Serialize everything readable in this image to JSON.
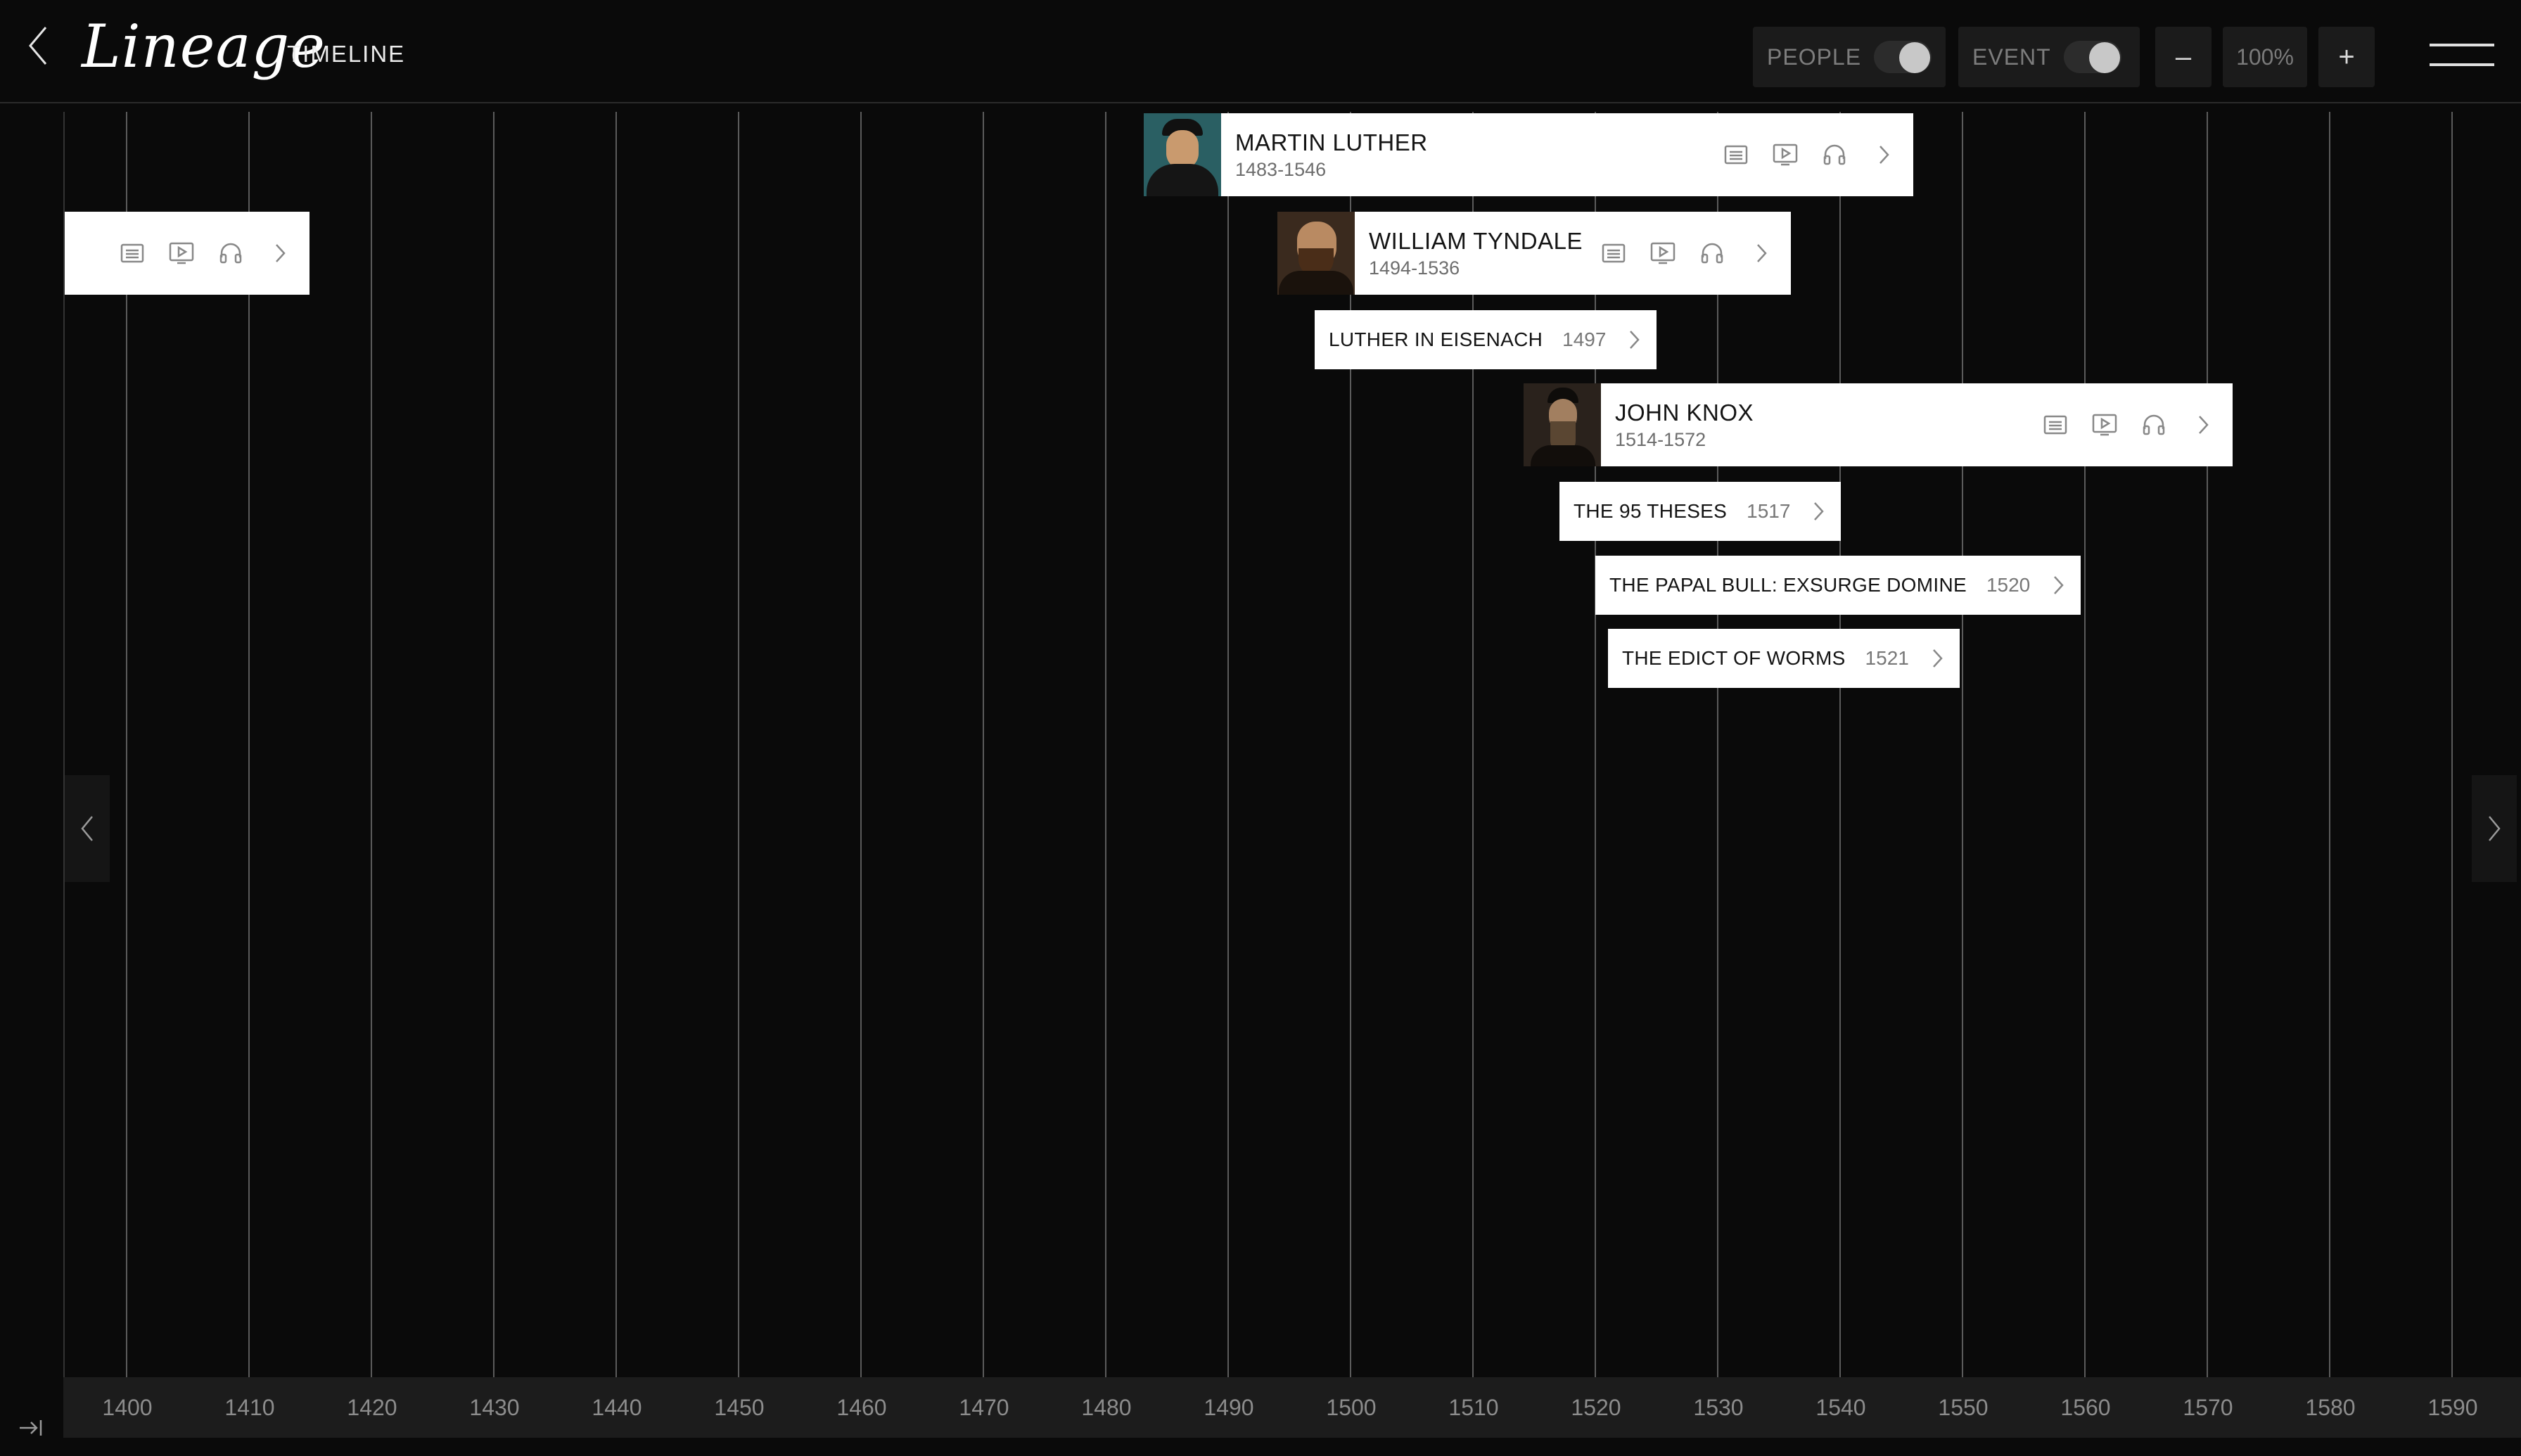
{
  "app": {
    "logo": "Lineage",
    "page_label": "TIMELINE"
  },
  "toolbar": {
    "people_label": "PEOPLE",
    "people_on": true,
    "event_label": "EVENT",
    "event_on": true,
    "zoom_out_label": "–",
    "zoom_in_label": "+",
    "zoom_value": "100%"
  },
  "people": [
    {
      "name": "MARTIN LUTHER",
      "dates": "1483-1546"
    },
    {
      "name": "WILLIAM TYNDALE",
      "dates": "1494-1536"
    },
    {
      "name": "JOHN KNOX",
      "dates": "1514-1572"
    }
  ],
  "events": [
    {
      "title": "LUTHER IN EISENACH",
      "year": "1497"
    },
    {
      "title": "THE 95 THESES",
      "year": "1517"
    },
    {
      "title": "THE PAPAL BULL: EXSURGE DOMINE",
      "year": "1520"
    },
    {
      "title": "THE EDICT OF WORMS",
      "year": "1521"
    }
  ],
  "axis": {
    "ticks": [
      "1400",
      "1410",
      "1420",
      "1430",
      "1440",
      "1450",
      "1460",
      "1470",
      "1480",
      "1490",
      "1500",
      "1510",
      "1520",
      "1530",
      "1540",
      "1550",
      "1560",
      "1570",
      "1580",
      "1590"
    ]
  },
  "colors": {
    "background": "#0a0a0a",
    "card": "#ffffff",
    "gridline": "#5b5b5b",
    "axis_bar": "#1c1c1c"
  }
}
